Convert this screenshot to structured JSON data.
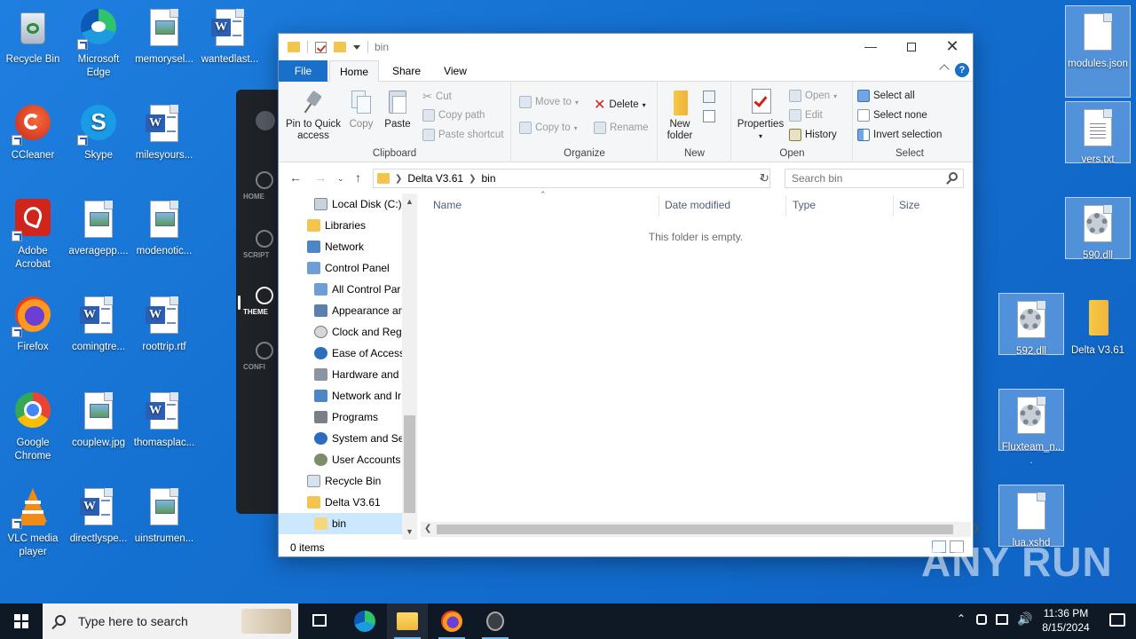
{
  "desktop": {
    "left_icons": [
      {
        "label": "Recycle Bin",
        "icon": "recycle-bin-icon"
      },
      {
        "label": "Microsoft Edge",
        "icon": "edge-icon"
      },
      {
        "label": "memorysel...",
        "icon": "image-file-icon"
      },
      {
        "label": "wantedlast...",
        "icon": "word-doc-icon"
      },
      {
        "label": "CCleaner",
        "icon": "ccleaner-icon"
      },
      {
        "label": "Skype",
        "icon": "skype-icon"
      },
      {
        "label": "milesyours...",
        "icon": "word-doc-icon"
      },
      {
        "label": "Adobe Acrobat",
        "icon": "acrobat-icon"
      },
      {
        "label": "averagepp....",
        "icon": "image-file-icon"
      },
      {
        "label": "modenotic...",
        "icon": "image-file-icon"
      },
      {
        "label": "Firefox",
        "icon": "firefox-icon"
      },
      {
        "label": "comingtre...",
        "icon": "word-doc-icon"
      },
      {
        "label": "roottrip.rtf",
        "icon": "word-doc-icon"
      },
      {
        "label": "Google Chrome",
        "icon": "chrome-icon"
      },
      {
        "label": "couplew.jpg",
        "icon": "image-file-icon"
      },
      {
        "label": "thomasplac...",
        "icon": "word-doc-icon"
      },
      {
        "label": "VLC media player",
        "icon": "vlc-icon"
      },
      {
        "label": "directlyspe...",
        "icon": "word-doc-icon"
      },
      {
        "label": "uinstrumen...",
        "icon": "image-file-icon"
      }
    ],
    "right_icons": [
      {
        "label": "modules.json",
        "icon": "blank-file-icon"
      },
      {
        "label": "vers.txt",
        "icon": "text-file-icon"
      },
      {
        "label": "590.dll",
        "icon": "dll-file-icon"
      },
      {
        "label": "592.dll",
        "icon": "dll-file-icon"
      },
      {
        "label": "Delta V3.61",
        "icon": "folder-icon"
      },
      {
        "label": "Fluxteam_n...",
        "icon": "dll-file-icon"
      },
      {
        "label": "lua.xshd",
        "icon": "blank-file-icon"
      }
    ]
  },
  "bg_app": {
    "items": [
      "HOME",
      "SCRIPT",
      "THEME",
      "CONFI"
    ]
  },
  "explorer": {
    "title": "bin",
    "tabs": [
      "File",
      "Home",
      "Share",
      "View"
    ],
    "ribbon": {
      "clipboard": {
        "name": "Clipboard",
        "pin": "Pin to Quick access",
        "copy": "Copy",
        "paste": "Paste",
        "cut": "Cut",
        "copy_path": "Copy path",
        "paste_shortcut": "Paste shortcut"
      },
      "organize": {
        "name": "Organize",
        "move_to": "Move to",
        "copy_to": "Copy to",
        "delete": "Delete",
        "rename": "Rename"
      },
      "new": {
        "name": "New",
        "new_folder": "New folder"
      },
      "open": {
        "name": "Open",
        "properties": "Properties",
        "open": "Open",
        "edit": "Edit",
        "history": "History"
      },
      "select": {
        "name": "Select",
        "select_all": "Select all",
        "select_none": "Select none",
        "invert_selection": "Invert selection"
      }
    },
    "address": {
      "crumbs": [
        "Delta V3.61",
        "bin"
      ],
      "search_placeholder": "Search bin"
    },
    "nav_items": [
      "Local Disk (C:)",
      "Libraries",
      "Network",
      "Control Panel",
      "All Control Par",
      "Appearance an",
      "Clock and Regi",
      "Ease of Access",
      "Hardware and",
      "Network and Ir",
      "Programs",
      "System and Sec",
      "User Accounts",
      "Recycle Bin",
      "Delta V3.61",
      "bin"
    ],
    "columns": [
      "Name",
      "Date modified",
      "Type",
      "Size"
    ],
    "empty_text": "This folder is empty.",
    "status": "0 items"
  },
  "taskbar": {
    "search_placeholder": "Type here to search",
    "time": "11:36 PM",
    "date": "8/15/2024"
  },
  "watermark": "ANY RUN"
}
